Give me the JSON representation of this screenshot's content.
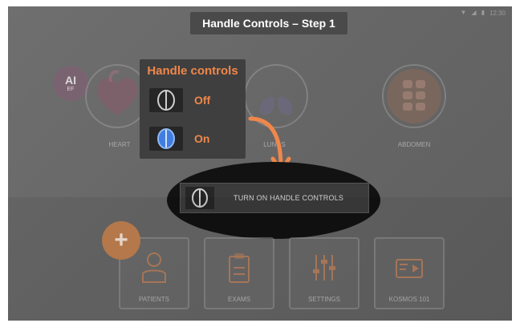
{
  "status_bar": {
    "time": "12:30"
  },
  "title": "Handle Controls – Step 1",
  "ai_badge": {
    "ai": "AI",
    "ef": "EF"
  },
  "organs": [
    {
      "label": "HEART",
      "icon": "heart-icon"
    },
    {
      "label": "LUNGS",
      "icon": "lungs-icon"
    },
    {
      "label": "ABDOMEN",
      "icon": "abdomen-icon"
    }
  ],
  "handle_controls": {
    "title": "Handle controls",
    "off_label": "Off",
    "on_label": "On"
  },
  "turn_on_button": {
    "label": "TURN ON HANDLE CONTROLS"
  },
  "fab": {
    "icon": "plus-icon"
  },
  "bottom_cards": [
    {
      "label": "PATIENTS",
      "icon": "patient-icon"
    },
    {
      "label": "EXAMS",
      "icon": "exams-clipboard-icon"
    },
    {
      "label": "SETTINGS",
      "icon": "sliders-icon"
    },
    {
      "label": "KOSMOS 101",
      "icon": "video-tutorial-icon"
    }
  ],
  "colors": {
    "accent_orange": "#f0874a",
    "spotlight": "#121212",
    "banner": "#4a4a4a"
  }
}
